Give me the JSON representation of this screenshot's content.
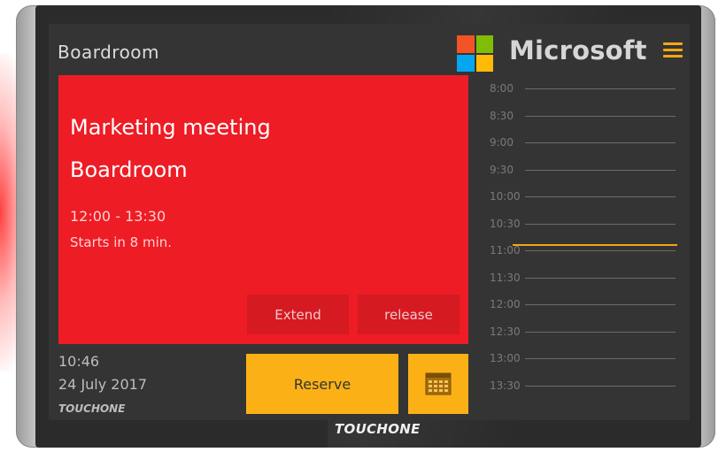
{
  "header": {
    "room": "Boardroom",
    "brand": "Microsoft"
  },
  "meeting": {
    "title": "Marketing meeting",
    "location": "Boardroom",
    "time": "12:00 - 13:30",
    "status": "Starts in 8 min.",
    "extend_label": "Extend",
    "release_label": "release"
  },
  "footer": {
    "clock": "10:46",
    "date": "24 July 2017",
    "brand": "TOUCHONE",
    "reserve_label": "Reserve"
  },
  "device_brand": "TOUCHONE",
  "timeline": {
    "slots": [
      "8:00",
      "8:30",
      "9:00",
      "9:30",
      "10:00",
      "10:30",
      "11:00",
      "11:30",
      "12:00",
      "12:30",
      "13:00",
      "13:30"
    ],
    "current_time": "10:46"
  },
  "colors": {
    "busy": "#ee1c25",
    "accent": "#fbb116",
    "now_line": "#f2a80f",
    "ms_red": "#f35325",
    "ms_green": "#81bc06",
    "ms_blue": "#05a6f0",
    "ms_yellow": "#ffba08"
  },
  "icons": {
    "menu": "hamburger-icon",
    "calendar": "calendar-icon",
    "logo": "microsoft-logo-icon"
  }
}
